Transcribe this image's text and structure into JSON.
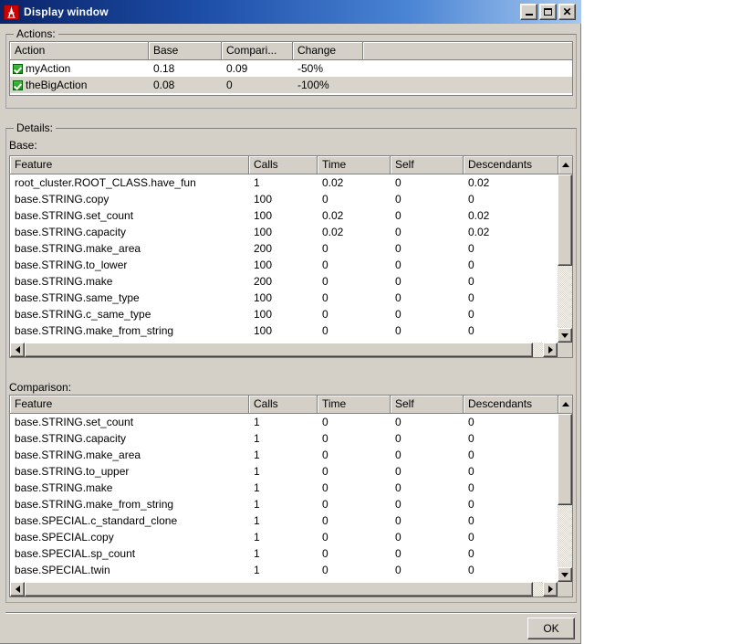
{
  "window": {
    "title": "Display window",
    "icon": "eiffel-tower-icon",
    "buttons": {
      "minimize": "minimize-icon",
      "maximize": "maximize-icon",
      "close": "close-icon"
    }
  },
  "actions_group": {
    "title": "Actions:",
    "columns": [
      "Action",
      "Base",
      "Compari...",
      "Change"
    ],
    "rows": [
      {
        "checked": true,
        "action": "myAction",
        "base": "0.18",
        "comparison": "0.09",
        "change": "-50%",
        "selected": false
      },
      {
        "checked": true,
        "action": "theBigAction",
        "base": "0.08",
        "comparison": "0",
        "change": "-100%",
        "selected": true
      }
    ]
  },
  "details_group": {
    "title": "Details:",
    "base_label": "Base:",
    "comparison_label": "Comparison:",
    "columns": [
      "Feature",
      "Calls",
      "Time",
      "Self",
      "Descendants"
    ],
    "base_rows": [
      {
        "feature": "root_cluster.ROOT_CLASS.have_fun",
        "calls": "1",
        "time": "0.02",
        "self": "0",
        "descendants": "0.02"
      },
      {
        "feature": "base.STRING.copy",
        "calls": "100",
        "time": "0",
        "self": "0",
        "descendants": "0"
      },
      {
        "feature": "base.STRING.set_count",
        "calls": "100",
        "time": "0.02",
        "self": "0",
        "descendants": "0.02"
      },
      {
        "feature": "base.STRING.capacity",
        "calls": "100",
        "time": "0.02",
        "self": "0",
        "descendants": "0.02"
      },
      {
        "feature": "base.STRING.make_area",
        "calls": "200",
        "time": "0",
        "self": "0",
        "descendants": "0"
      },
      {
        "feature": "base.STRING.to_lower",
        "calls": "100",
        "time": "0",
        "self": "0",
        "descendants": "0"
      },
      {
        "feature": "base.STRING.make",
        "calls": "200",
        "time": "0",
        "self": "0",
        "descendants": "0"
      },
      {
        "feature": "base.STRING.same_type",
        "calls": "100",
        "time": "0",
        "self": "0",
        "descendants": "0"
      },
      {
        "feature": "base.STRING.c_same_type",
        "calls": "100",
        "time": "0",
        "self": "0",
        "descendants": "0"
      },
      {
        "feature": "base.STRING.make_from_string",
        "calls": "100",
        "time": "0",
        "self": "0",
        "descendants": "0"
      }
    ],
    "comparison_rows": [
      {
        "feature": "base.STRING.set_count",
        "calls": "1",
        "time": "0",
        "self": "0",
        "descendants": "0"
      },
      {
        "feature": "base.STRING.capacity",
        "calls": "1",
        "time": "0",
        "self": "0",
        "descendants": "0"
      },
      {
        "feature": "base.STRING.make_area",
        "calls": "1",
        "time": "0",
        "self": "0",
        "descendants": "0"
      },
      {
        "feature": "base.STRING.to_upper",
        "calls": "1",
        "time": "0",
        "self": "0",
        "descendants": "0"
      },
      {
        "feature": "base.STRING.make",
        "calls": "1",
        "time": "0",
        "self": "0",
        "descendants": "0"
      },
      {
        "feature": "base.STRING.make_from_string",
        "calls": "1",
        "time": "0",
        "self": "0",
        "descendants": "0"
      },
      {
        "feature": "base.SPECIAL.c_standard_clone",
        "calls": "1",
        "time": "0",
        "self": "0",
        "descendants": "0"
      },
      {
        "feature": "base.SPECIAL.copy",
        "calls": "1",
        "time": "0",
        "self": "0",
        "descendants": "0"
      },
      {
        "feature": "base.SPECIAL.sp_count",
        "calls": "1",
        "time": "0",
        "self": "0",
        "descendants": "0"
      },
      {
        "feature": "base.SPECIAL.twin",
        "calls": "1",
        "time": "0",
        "self": "0",
        "descendants": "0"
      }
    ]
  },
  "footer": {
    "ok_label": "OK"
  },
  "colors": {
    "title_start": "#0a246a",
    "title_end": "#a6c8ee",
    "face": "#d4d0c8",
    "selection": "#d8d4cc",
    "checkbox_green": "#119911",
    "icon_red": "#cc0000"
  }
}
